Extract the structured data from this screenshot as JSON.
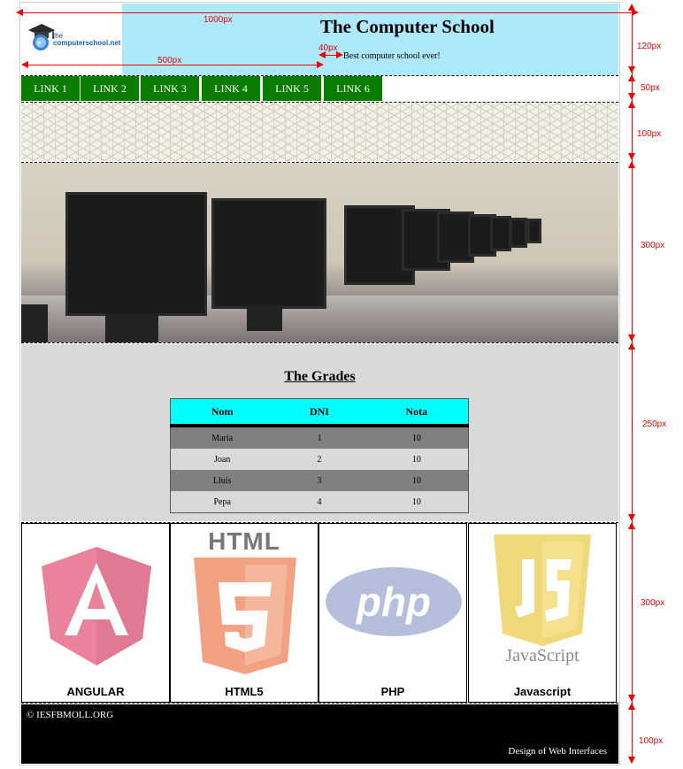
{
  "header": {
    "title": "The Computer School",
    "tagline": "Best computer school ever!",
    "logo_text_1": "the",
    "logo_text_2": "computerschool.net"
  },
  "nav": {
    "items": [
      {
        "label": "LINK 1"
      },
      {
        "label": "LINK 2"
      },
      {
        "label": "LINK 3"
      },
      {
        "label": "LINK 4"
      },
      {
        "label": "LINK 5"
      },
      {
        "label": "LINK 6"
      }
    ]
  },
  "grades": {
    "title": "The Grades",
    "columns": [
      "Nom",
      "DNI",
      "Nota"
    ],
    "rows": [
      [
        "Maria",
        "1",
        "10"
      ],
      [
        "Joan",
        "2",
        "10"
      ],
      [
        "Lluis",
        "3",
        "10"
      ],
      [
        "Pepa",
        "4",
        "10"
      ]
    ]
  },
  "technologies": [
    {
      "label": "ANGULAR",
      "icon": "angular-logo-icon"
    },
    {
      "label": "HTML5",
      "icon": "html5-logo-icon",
      "heading": "HTML"
    },
    {
      "label": "PHP",
      "icon": "php-logo-icon",
      "text": "php"
    },
    {
      "label": "Javascript",
      "icon": "javascript-logo-icon",
      "text": "JavaScript"
    }
  ],
  "footer": {
    "copyright": "© IESFBMOLL.ORG",
    "credit": "Design of Web Interfaces"
  },
  "annotations": {
    "width_total": "1000px",
    "width_logo": "500px",
    "width_gap": "40px",
    "h_header": "120px",
    "h_nav": "50px",
    "h_pattern": "100px",
    "h_hero": "300px",
    "h_grades": "250px",
    "h_logos": "300px",
    "h_footer": "100px"
  },
  "colors": {
    "header_bg": "#aee8fb",
    "nav_bg": "#0a7c00",
    "table_header": "#00ffff",
    "row_dark": "#808080",
    "row_light": "#d9d9d9",
    "section_bg": "#d9d9d9",
    "footer_bg": "#000000"
  }
}
